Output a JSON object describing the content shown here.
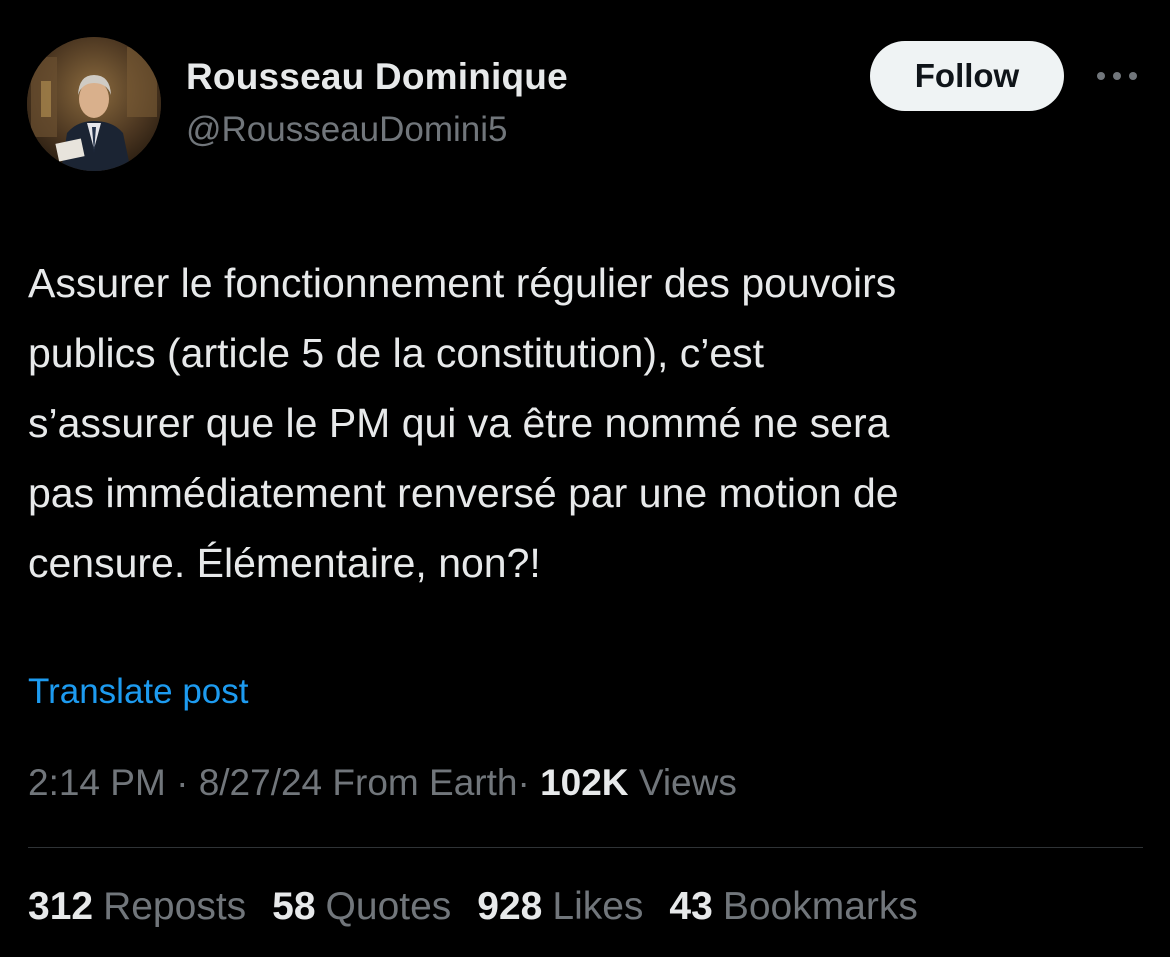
{
  "author": {
    "display_name": "Rousseau Dominique",
    "handle": "@RousseauDomini5"
  },
  "follow_label": "Follow",
  "more_icon": "more-horizontal-icon",
  "post": {
    "lines": [
      "Assurer le fonctionnement régulier des pouvoirs",
      "publics (article 5 de la constitution), c’est",
      "s’assurer que le PM qui va être nommé ne sera",
      "pas immédiatement renversé par une motion de",
      "censure. Élémentaire, non?!"
    ]
  },
  "translate_label": "Translate post",
  "meta": {
    "time": "2:14 PM",
    "separator": "·",
    "date": "8/27/24",
    "source": "From Earth",
    "views_count": "102K",
    "views_label": "Views"
  },
  "stats": {
    "reposts": {
      "count": "312",
      "label": "Reposts"
    },
    "quotes": {
      "count": "58",
      "label": "Quotes"
    },
    "likes": {
      "count": "928",
      "label": "Likes"
    },
    "bookmarks": {
      "count": "43",
      "label": "Bookmarks"
    }
  },
  "colors": {
    "background": "#000000",
    "primary_text": "#e7e9ea",
    "secondary_text": "#71767b",
    "link": "#1d9bf0",
    "follow_button_bg": "#eff3f4",
    "divider": "#2f3336"
  }
}
